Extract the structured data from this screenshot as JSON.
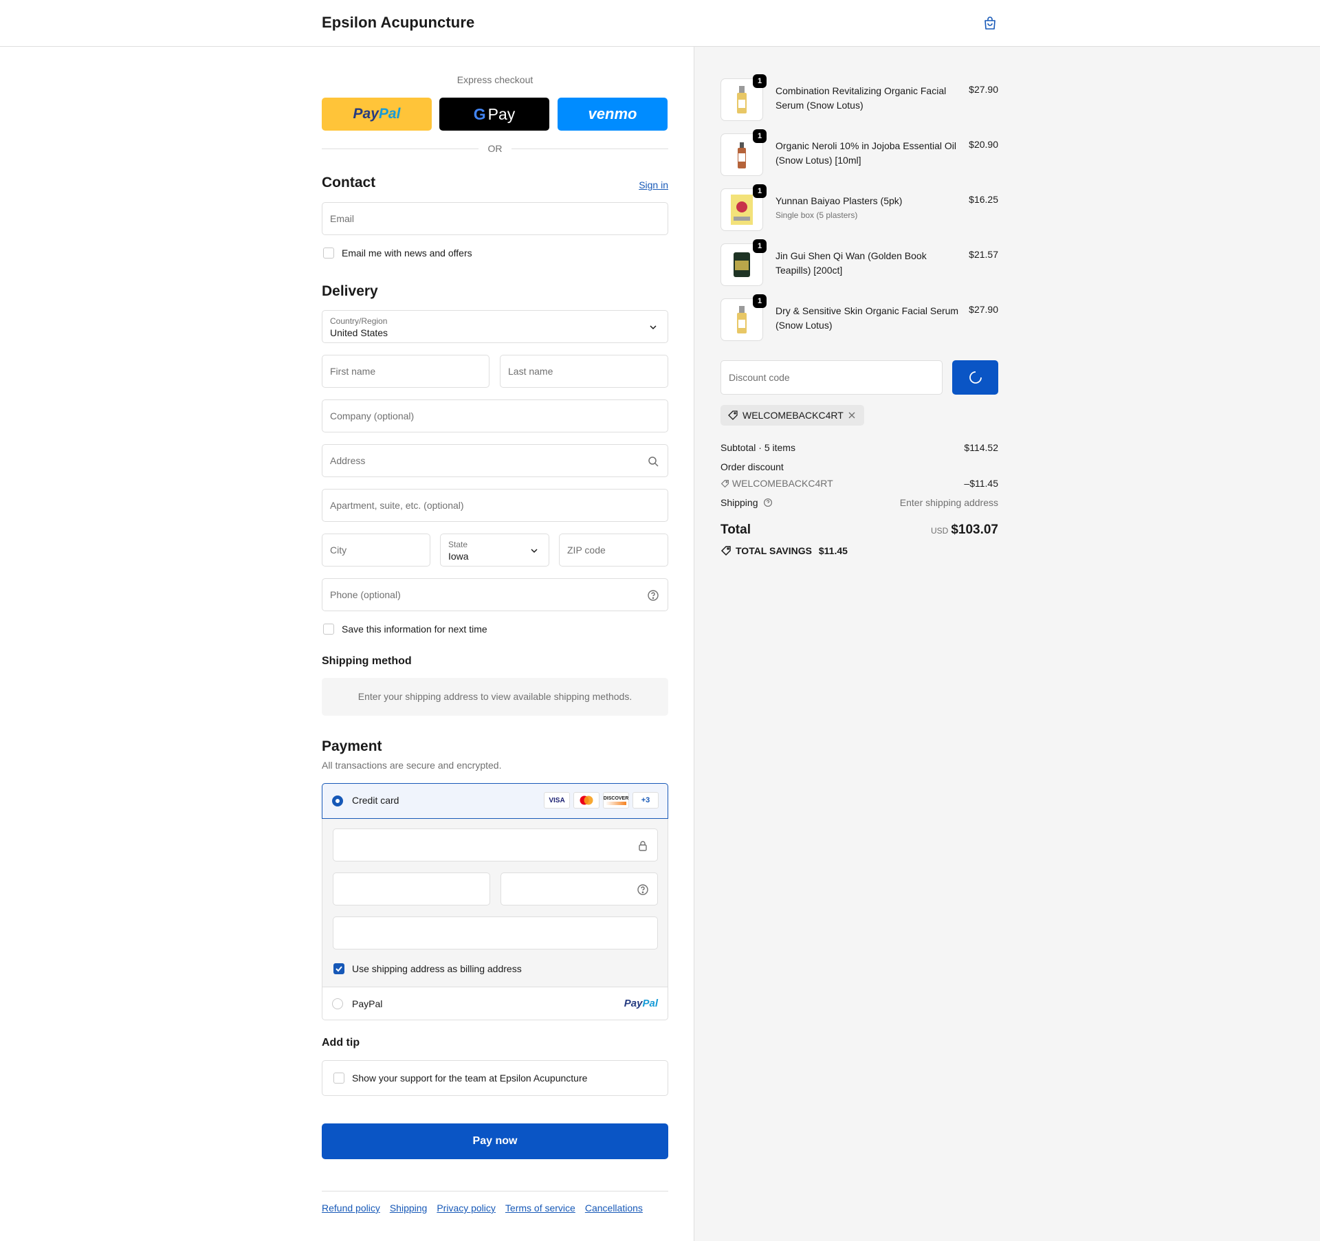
{
  "header": {
    "brand": "Epsilon Acupuncture"
  },
  "express": {
    "label": "Express checkout",
    "paypal_text_a": "Pay",
    "paypal_text_b": "Pal",
    "gpay_text": "Pay",
    "venmo_text": "venmo",
    "or_text": "OR"
  },
  "contact": {
    "title": "Contact",
    "sign_in": "Sign in",
    "email_placeholder": "Email",
    "news_label": "Email me with news and offers"
  },
  "delivery": {
    "title": "Delivery",
    "country_label": "Country/Region",
    "country_value": "United States",
    "first_name": "First name",
    "last_name": "Last name",
    "company": "Company (optional)",
    "address": "Address",
    "apartment": "Apartment, suite, etc. (optional)",
    "city": "City",
    "state_label": "State",
    "state_value": "Iowa",
    "zip": "ZIP code",
    "phone": "Phone (optional)",
    "save_info": "Save this information for next time"
  },
  "shipping_method": {
    "title": "Shipping method",
    "message": "Enter your shipping address to view available shipping methods."
  },
  "payment": {
    "title": "Payment",
    "subtitle": "All transactions are secure and encrypted.",
    "credit_card": "Credit card",
    "card_logos": [
      "VISA",
      "mastercard",
      "DISCOVER",
      "+3"
    ],
    "billing_label": "Use shipping address as billing address",
    "paypal_option": "PayPal",
    "paypal_logo_a": "Pay",
    "paypal_logo_b": "Pal"
  },
  "tip": {
    "title": "Add tip",
    "label": "Show your support for the team at Epsilon Acupuncture"
  },
  "pay_now": "Pay now",
  "footer_links": [
    "Refund policy",
    "Shipping",
    "Privacy policy",
    "Terms of service",
    "Cancellations"
  ],
  "order": {
    "items": [
      {
        "name": "Combination Revitalizing Organic Facial Serum (Snow Lotus)",
        "variant": "",
        "price": "$27.90",
        "qty": "1"
      },
      {
        "name": "Organic Neroli 10% in Jojoba Essential Oil (Snow Lotus) [10ml]",
        "variant": "",
        "price": "$20.90",
        "qty": "1"
      },
      {
        "name": "Yunnan Baiyao Plasters (5pk)",
        "variant": "Single box (5 plasters)",
        "price": "$16.25",
        "qty": "1"
      },
      {
        "name": "Jin Gui Shen Qi Wan (Golden Book Teapills) [200ct]",
        "variant": "",
        "price": "$21.57",
        "qty": "1"
      },
      {
        "name": "Dry & Sensitive Skin Organic Facial Serum (Snow Lotus)",
        "variant": "",
        "price": "$27.90",
        "qty": "1"
      }
    ],
    "discount_placeholder": "Discount code",
    "applied_code": "WELCOMEBACKC4RT",
    "subtotal_label": "Subtotal · 5 items",
    "subtotal_value": "$114.52",
    "order_discount_label": "Order discount",
    "discount_code_line": "WELCOMEBACKC4RT",
    "discount_value": "–$11.45",
    "shipping_label": "Shipping",
    "shipping_value": "Enter shipping address",
    "total_label": "Total",
    "currency": "USD",
    "total_value": "$103.07",
    "savings_label": "TOTAL SAVINGS",
    "savings_value": "$11.45"
  },
  "colors": {
    "accent": "#0a55c5",
    "link": "#1658b7",
    "paypal_yellow": "#ffc439",
    "venmo_blue": "#008cff"
  }
}
